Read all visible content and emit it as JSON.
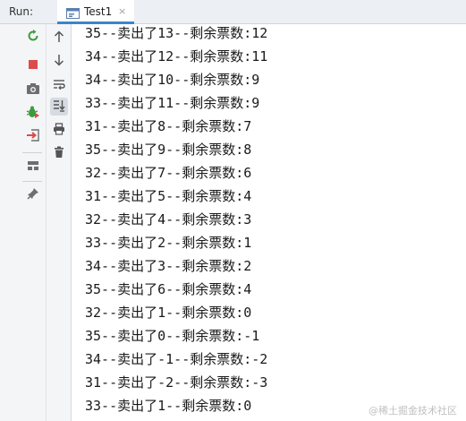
{
  "window": {
    "run_label": "Run:",
    "tab_title": "Test1",
    "tab_close": "×"
  },
  "toolbar_left": [
    {
      "name": "rerun-icon",
      "color": "#3d9b3d"
    },
    {
      "name": "stop-icon",
      "color": "#db4b4b"
    },
    {
      "name": "camera-icon",
      "color": "#6e6e6e"
    },
    {
      "name": "debug-icon",
      "color": "#3d9b3d"
    },
    {
      "name": "exit-icon",
      "color": "#db4b4b"
    },
    {
      "name": "layout-icon",
      "color": "#6e6e6e"
    },
    {
      "name": "pin-icon",
      "color": "#6e6e6e"
    }
  ],
  "toolbar_right": [
    {
      "name": "arrow-up-icon"
    },
    {
      "name": "arrow-down-icon"
    },
    {
      "name": "soft-wrap-icon"
    },
    {
      "name": "scroll-to-end-icon"
    },
    {
      "name": "print-icon"
    },
    {
      "name": "trash-icon"
    }
  ],
  "console": {
    "lines": [
      "35--卖出了13--剩余票数:12",
      "34--卖出了12--剩余票数:11",
      "34--卖出了10--剩余票数:9",
      "33--卖出了11--剩余票数:9",
      "31--卖出了8--剩余票数:7",
      "35--卖出了9--剩余票数:8",
      "32--卖出了7--剩余票数:6",
      "31--卖出了5--剩余票数:4",
      "32--卖出了4--剩余票数:3",
      "33--卖出了2--剩余票数:1",
      "34--卖出了3--剩余票数:2",
      "35--卖出了6--剩余票数:4",
      "32--卖出了1--剩余票数:0",
      "35--卖出了0--剩余票数:-1",
      "34--卖出了-1--剩余票数:-2",
      "31--卖出了-2--剩余票数:-3",
      "33--卖出了1--剩余票数:0"
    ]
  },
  "watermark": "@稀土掘金技术社区"
}
